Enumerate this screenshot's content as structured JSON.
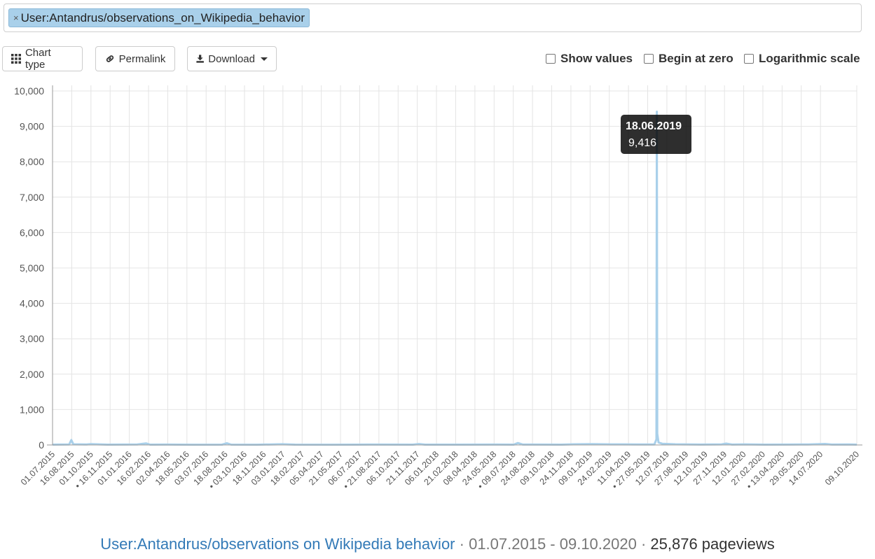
{
  "search": {
    "tag_remove": "×",
    "tag_label": "User:Antandrus/observations_on_Wikipedia_behavior"
  },
  "toolbar": {
    "chart_type_label": "Chart type",
    "permalink_label": "Permalink",
    "download_label": "Download"
  },
  "options": {
    "show_values_label": "Show values",
    "begin_at_zero_label": "Begin at zero",
    "log_scale_label": "Logarithmic scale"
  },
  "tooltip": {
    "date": "18.06.2019",
    "value": "9,416"
  },
  "footer": {
    "article": "User:Antandrus/observations on Wikipedia behavior",
    "sep1": " · ",
    "range": "01.07.2015 - 09.10.2020",
    "sep2": " · ",
    "pageviews": "25,876 pageviews"
  },
  "colors": {
    "line": "#a9d0ea",
    "grid": "#e4e4e4",
    "axis": "#9a9a9a"
  },
  "chart_data": {
    "type": "line",
    "ylim": [
      0,
      10000
    ],
    "yticks": [
      0,
      1000,
      2000,
      3000,
      4000,
      5000,
      6000,
      7000,
      8000,
      9000,
      10000
    ],
    "ytick_labels": [
      "0",
      "1,000",
      "2,000",
      "3,000",
      "4,000",
      "5,000",
      "6,000",
      "7,000",
      "8,000",
      "9,000",
      "10,000"
    ],
    "xlim": [
      "2015-07-01",
      "2020-10-09"
    ],
    "xticks": [
      {
        "date": "2015-07-01",
        "label": "01.07.2015"
      },
      {
        "date": "2015-08-16",
        "label": "16.08.2015"
      },
      {
        "date": "2015-10-01",
        "label": "01.10.2015"
      },
      {
        "date": "2015-11-16",
        "label": "• 16.11.2015"
      },
      {
        "date": "2016-01-01",
        "label": "01.01.2016"
      },
      {
        "date": "2016-02-16",
        "label": "16.02.2016"
      },
      {
        "date": "2016-04-02",
        "label": "02.04.2016"
      },
      {
        "date": "2016-05-18",
        "label": "18.05.2016"
      },
      {
        "date": "2016-07-03",
        "label": "03.07.2016"
      },
      {
        "date": "2016-08-18",
        "label": "18.08.2016"
      },
      {
        "date": "2016-10-03",
        "label": "• 03.10.2016"
      },
      {
        "date": "2016-11-18",
        "label": "18.11.2016"
      },
      {
        "date": "2017-01-03",
        "label": "03.01.2017"
      },
      {
        "date": "2017-02-18",
        "label": "18.02.2017"
      },
      {
        "date": "2017-04-05",
        "label": "05.04.2017"
      },
      {
        "date": "2017-05-21",
        "label": "21.05.2017"
      },
      {
        "date": "2017-07-06",
        "label": "06.07.2017"
      },
      {
        "date": "2017-08-21",
        "label": "• 21.08.2017"
      },
      {
        "date": "2017-10-06",
        "label": "06.10.2017"
      },
      {
        "date": "2017-11-21",
        "label": "21.11.2017"
      },
      {
        "date": "2018-01-06",
        "label": "06.01.2018"
      },
      {
        "date": "2018-02-21",
        "label": "21.02.2018"
      },
      {
        "date": "2018-04-08",
        "label": "08.04.2018"
      },
      {
        "date": "2018-05-24",
        "label": "24.05.2018"
      },
      {
        "date": "2018-07-09",
        "label": "• 09.07.2018"
      },
      {
        "date": "2018-08-24",
        "label": "24.08.2018"
      },
      {
        "date": "2018-10-09",
        "label": "09.10.2018"
      },
      {
        "date": "2018-11-24",
        "label": "24.11.2018"
      },
      {
        "date": "2019-01-09",
        "label": "09.01.2019"
      },
      {
        "date": "2019-02-24",
        "label": "24.02.2019"
      },
      {
        "date": "2019-04-11",
        "label": "11.04.2019"
      },
      {
        "date": "2019-05-27",
        "label": "• 27.05.2019"
      },
      {
        "date": "2019-07-12",
        "label": "12.07.2019"
      },
      {
        "date": "2019-08-27",
        "label": "27.08.2019"
      },
      {
        "date": "2019-10-12",
        "label": "12.10.2019"
      },
      {
        "date": "2019-11-27",
        "label": "27.11.2019"
      },
      {
        "date": "2020-01-12",
        "label": "12.01.2020"
      },
      {
        "date": "2020-02-27",
        "label": "27.02.2020"
      },
      {
        "date": "2020-04-13",
        "label": "• 13.04.2020"
      },
      {
        "date": "2020-05-29",
        "label": "29.05.2020"
      },
      {
        "date": "2020-07-14",
        "label": "14.07.2020"
      },
      {
        "date": "2020-10-09",
        "label": "09.10.2020"
      }
    ],
    "points": [
      {
        "x": "2015-07-01",
        "y": 10
      },
      {
        "x": "2015-08-10",
        "y": 15
      },
      {
        "x": "2015-08-15",
        "y": 140
      },
      {
        "x": "2015-08-20",
        "y": 20
      },
      {
        "x": "2015-09-20",
        "y": 15
      },
      {
        "x": "2015-10-01",
        "y": 25
      },
      {
        "x": "2015-11-10",
        "y": 10
      },
      {
        "x": "2016-01-20",
        "y": 15
      },
      {
        "x": "2016-02-10",
        "y": 45
      },
      {
        "x": "2016-02-20",
        "y": 10
      },
      {
        "x": "2016-04-01",
        "y": 12
      },
      {
        "x": "2016-06-01",
        "y": 8
      },
      {
        "x": "2016-08-10",
        "y": 10
      },
      {
        "x": "2016-08-22",
        "y": 50
      },
      {
        "x": "2016-09-01",
        "y": 10
      },
      {
        "x": "2016-11-01",
        "y": 8
      },
      {
        "x": "2017-01-01",
        "y": 22
      },
      {
        "x": "2017-02-01",
        "y": 10
      },
      {
        "x": "2017-05-01",
        "y": 8
      },
      {
        "x": "2017-08-01",
        "y": 12
      },
      {
        "x": "2017-11-10",
        "y": 10
      },
      {
        "x": "2017-11-25",
        "y": 28
      },
      {
        "x": "2017-12-10",
        "y": 10
      },
      {
        "x": "2018-03-01",
        "y": 10
      },
      {
        "x": "2018-06-01",
        "y": 12
      },
      {
        "x": "2018-07-10",
        "y": 10
      },
      {
        "x": "2018-07-20",
        "y": 55
      },
      {
        "x": "2018-08-01",
        "y": 12
      },
      {
        "x": "2018-11-01",
        "y": 10
      },
      {
        "x": "2018-12-01",
        "y": 20
      },
      {
        "x": "2019-01-15",
        "y": 25
      },
      {
        "x": "2019-03-01",
        "y": 18
      },
      {
        "x": "2019-05-01",
        "y": 15
      },
      {
        "x": "2019-06-12",
        "y": 15
      },
      {
        "x": "2019-06-17",
        "y": 160
      },
      {
        "x": "2019-06-18",
        "y": 9416
      },
      {
        "x": "2019-06-19",
        "y": 320
      },
      {
        "x": "2019-06-22",
        "y": 70
      },
      {
        "x": "2019-07-01",
        "y": 35
      },
      {
        "x": "2019-08-01",
        "y": 20
      },
      {
        "x": "2019-10-01",
        "y": 12
      },
      {
        "x": "2019-11-20",
        "y": 18
      },
      {
        "x": "2019-12-01",
        "y": 40
      },
      {
        "x": "2019-12-15",
        "y": 12
      },
      {
        "x": "2020-01-15",
        "y": 18
      },
      {
        "x": "2020-03-01",
        "y": 10
      },
      {
        "x": "2020-05-01",
        "y": 12
      },
      {
        "x": "2020-06-15",
        "y": 15
      },
      {
        "x": "2020-07-25",
        "y": 30
      },
      {
        "x": "2020-08-10",
        "y": 12
      },
      {
        "x": "2020-09-20",
        "y": 15
      },
      {
        "x": "2020-10-09",
        "y": 10
      }
    ]
  }
}
